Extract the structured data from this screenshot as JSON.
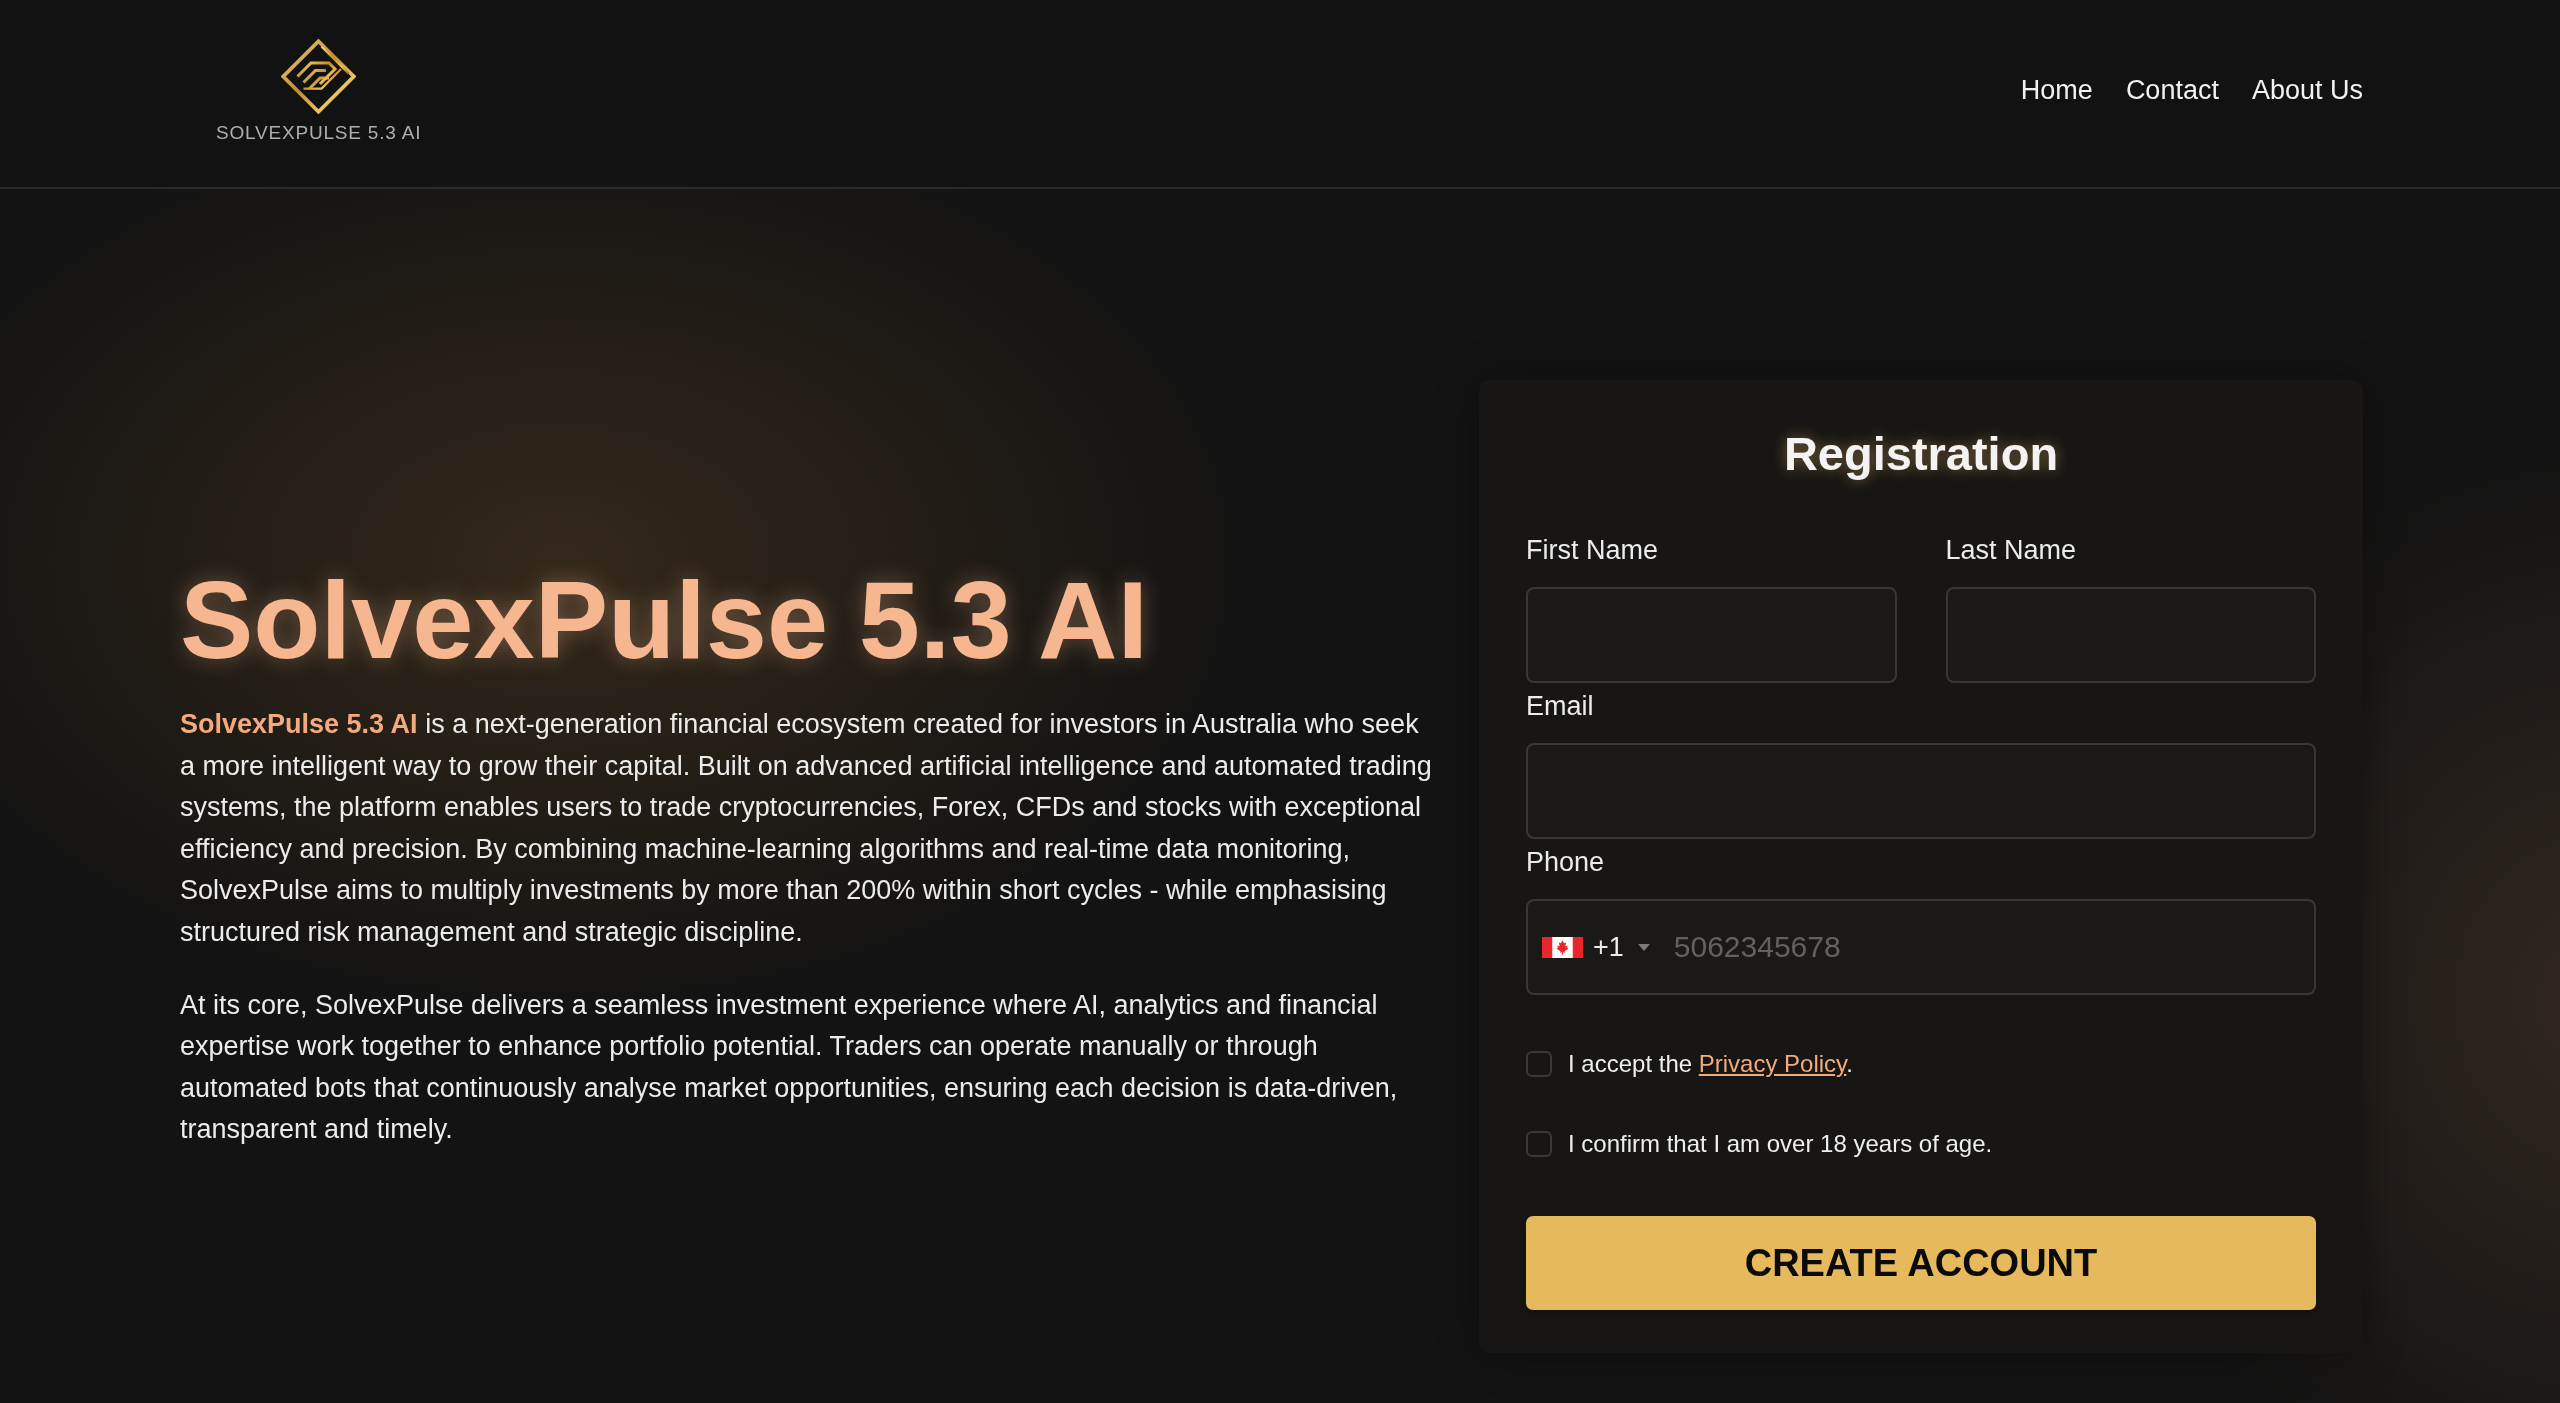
{
  "header": {
    "brand": "SOLVEXPULSE 5.3 AI",
    "nav": [
      {
        "label": "Home"
      },
      {
        "label": "Contact"
      },
      {
        "label": "About Us"
      }
    ]
  },
  "hero": {
    "title": "SolvexPulse 5.3 AI",
    "paragraphs": [
      "**SolvexPulse 5.3 AI** is a next-generation financial ecosystem created for investors in Australia who seek a more intelligent way to grow their capital. Built on advanced artificial intelligence and automated trading systems, the platform enables users to trade cryptocurrencies, Forex, CFDs and stocks with exceptional efficiency and precision. By combining machine-learning algorithms and real-time data monitoring, SolvexPulse aims to multiply investments by more than 200% within short cycles - while emphasising structured risk management and strategic discipline.",
      "At its core, SolvexPulse delivers a seamless investment experience where AI, analytics and financial expertise work together to enhance portfolio potential. Traders can operate manually or through automated bots that continuously analyse market opportunities, ensuring each decision is data-driven, transparent and timely."
    ]
  },
  "registration": {
    "title": "Registration",
    "field_rows": [
      [
        {
          "label": "First Name"
        },
        {
          "label": "Last Name"
        }
      ],
      [
        {
          "label": "Email"
        }
      ]
    ],
    "phone": {
      "label": "Phone",
      "dial_code": "+1",
      "placeholder": "5062345678"
    },
    "consents": [
      {
        "text": "I accept the ",
        "link": "Privacy Policy",
        "after_link": ".",
        "checked": false
      },
      {
        "text": "I confirm that I am over 18 years of age.",
        "checked": false
      }
    ],
    "submit": "CREATE ACCOUNT"
  }
}
